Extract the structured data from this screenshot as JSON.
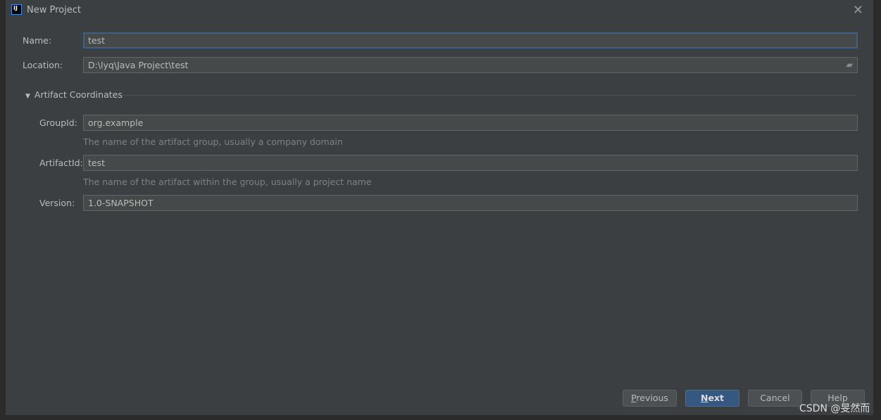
{
  "dialog": {
    "title": "New Project",
    "logo": "IJ"
  },
  "form": {
    "name_label": "Name:",
    "name_value": "test",
    "location_label": "Location:",
    "location_value": "D:\\lyq\\Java Project\\test"
  },
  "artifact": {
    "section_label": "Artifact Coordinates",
    "group_label": "GroupId:",
    "group_value": "org.example",
    "group_hint": "The name of the artifact group, usually a company domain",
    "artifact_label": "ArtifactId:",
    "artifact_value": "test",
    "artifact_hint": "The name of the artifact within the group, usually a project name",
    "version_label": "Version:",
    "version_value": "1.0-SNAPSHOT"
  },
  "buttons": {
    "previous_first": "P",
    "previous_rest": "revious",
    "next_first": "N",
    "next_rest": "ext",
    "cancel": "Cancel",
    "help": "Help"
  },
  "watermark": "CSDN @旻然而",
  "colors": {
    "accent": "#365880",
    "focus": "#3d6185"
  }
}
